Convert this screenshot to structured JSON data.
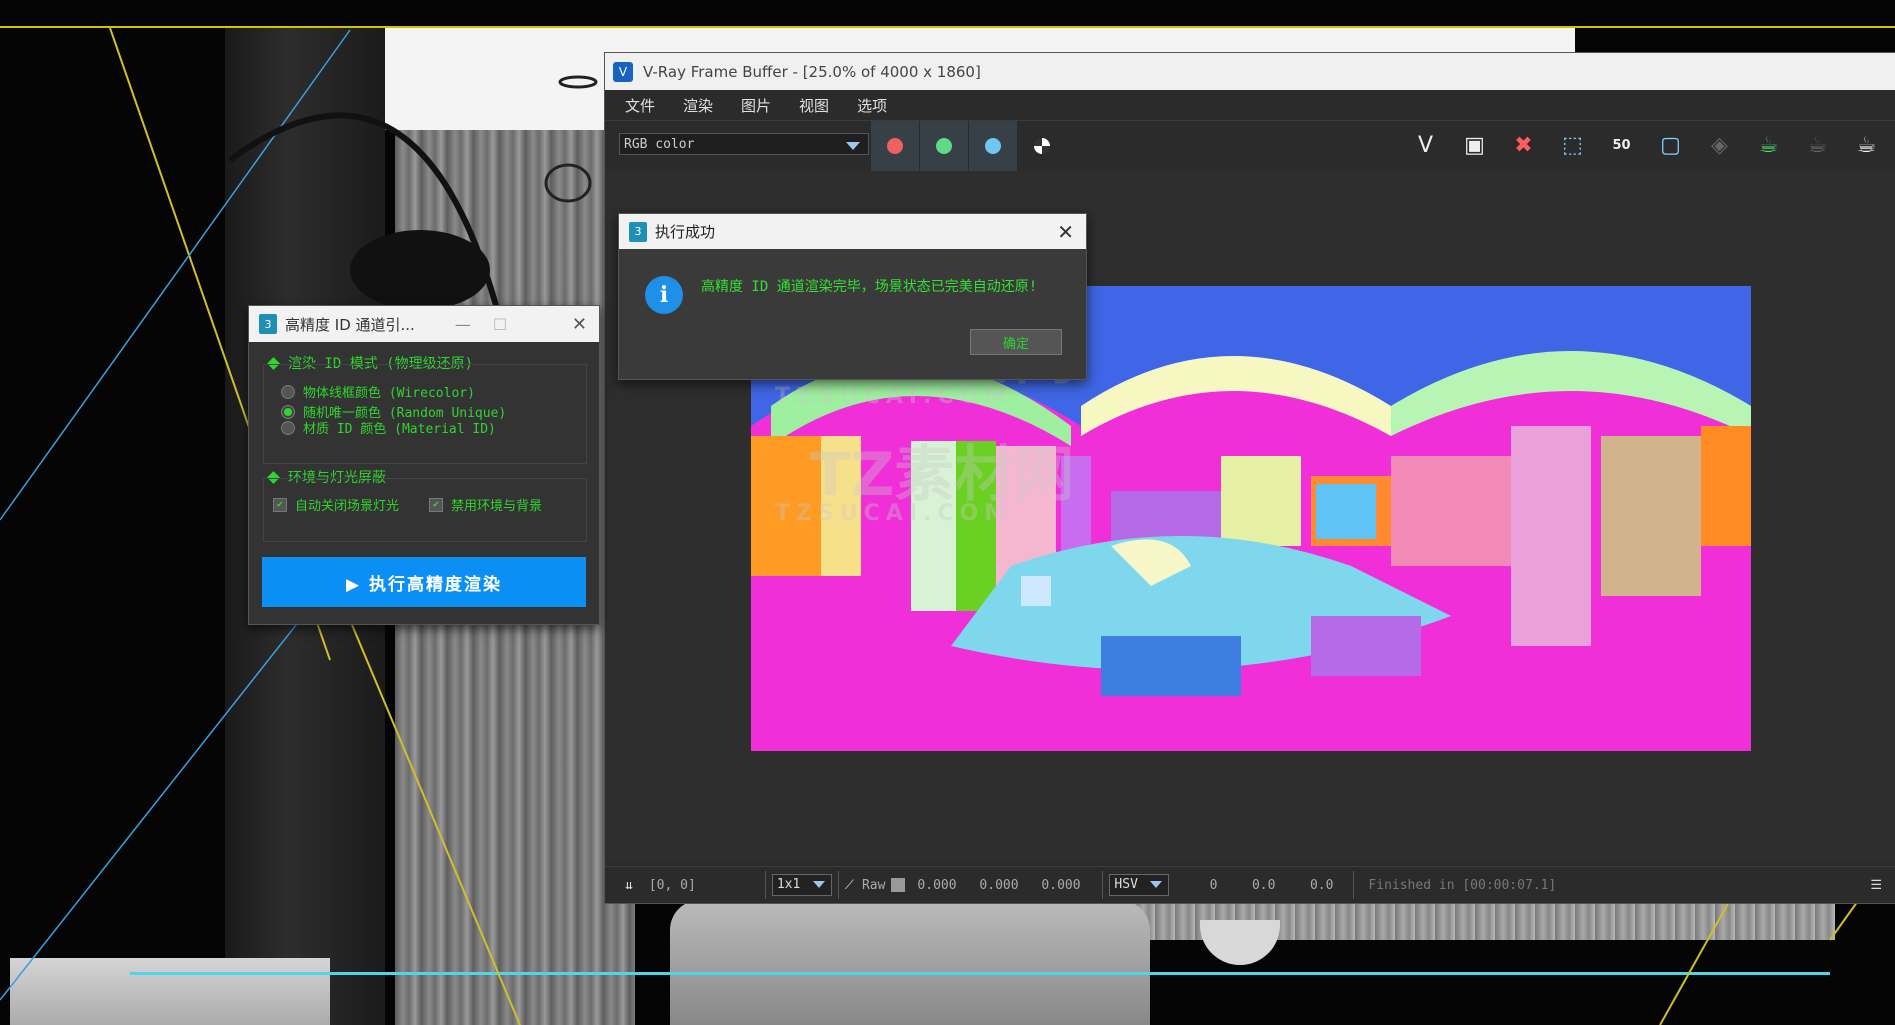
{
  "vfb": {
    "title": "V-Ray Frame Buffer - [25.0% of 4000 x 1860]",
    "icon_label": "V",
    "menu": [
      "文件",
      "渲染",
      "图片",
      "视图",
      "选项"
    ],
    "channel": "RGB color",
    "channel_colors": {
      "red": "#f06060",
      "green": "#62d98a",
      "blue": "#6fc6f5"
    },
    "toolbar_icons": [
      "vray-logo-icon",
      "save-icon",
      "clear-image-icon",
      "region-render-icon",
      "zoom-50-icon",
      "fit-window-icon",
      "track-mouse-icon",
      "render-icon",
      "stop-render-icon",
      "teapot-icon"
    ],
    "zoom_label": "50",
    "status": {
      "coords": "[0, 0]",
      "scale": "1x1",
      "raw_label": "Raw",
      "r": "0.000",
      "g": "0.000",
      "b": "0.000",
      "colorspace": "HSV",
      "h": "0",
      "s": "0.0",
      "v": "0.0",
      "finished": "Finished in [00:00:07.1]"
    }
  },
  "watermark": {
    "line1": "TZ素材网",
    "line2": "TZSUCAI.COM"
  },
  "success_dialog": {
    "title": "执行成功",
    "icon_label": "3",
    "message": "高精度 ID 通道渲染完毕，场景状态已完美自动还原!",
    "ok_label": "确定"
  },
  "tool_panel": {
    "title": "高精度 ID 通道引...",
    "icon_label": "3",
    "group1_title": "渲染 ID 模式 (物理级还原)",
    "options": [
      {
        "label": "物体线框颜色 (Wirecolor)",
        "selected": false
      },
      {
        "label": "随机唯一颜色 (Random Unique)",
        "selected": true
      },
      {
        "label": "材质 ID 颜色 (Material ID)",
        "selected": false
      }
    ],
    "group2_title": "环境与灯光屏蔽",
    "checks": [
      "自动关闭场景灯光",
      "禁用环境与背景"
    ],
    "execute_label": "▶ 执行高精度渲染"
  }
}
